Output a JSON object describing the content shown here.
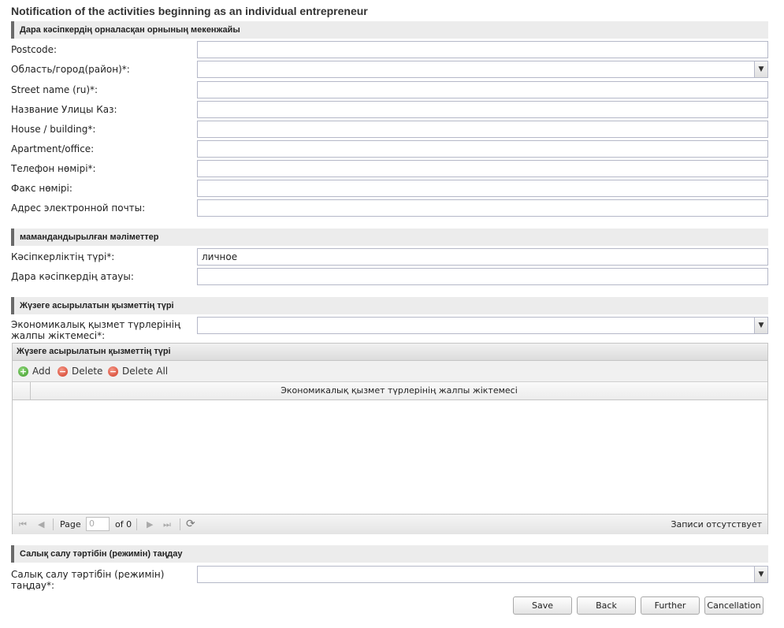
{
  "page": {
    "title": "Notification of the activities beginning as an individual entrepreneur"
  },
  "section_address": {
    "header": "Дара кәсіпкердің орналасқан орнының мекенжайы",
    "fields": [
      {
        "label": "Postcode:",
        "value": ""
      },
      {
        "label": "Область/город(район)*:",
        "value": ""
      },
      {
        "label": "Street name (ru)*:",
        "value": ""
      },
      {
        "label": "Название Улицы Каз:",
        "value": ""
      },
      {
        "label": "House / building*:",
        "value": ""
      },
      {
        "label": "Apartment/office:",
        "value": ""
      },
      {
        "label": "Телефон нөмірі*:",
        "value": ""
      },
      {
        "label": "Факс нөмірі:",
        "value": ""
      },
      {
        "label": "Адрес электронной почты:",
        "value": ""
      }
    ]
  },
  "section_specialized": {
    "header": "мамандандырылған мәліметтер",
    "fields": [
      {
        "label": "Кәсіпкерліктің түрі*:",
        "value": "личное"
      },
      {
        "label": "Дара кәсіпкердің атауы:",
        "value": ""
      }
    ]
  },
  "section_activity": {
    "header": "Жүзеге асырылатын қызметтің түрі",
    "classifier_label": "Экономикалық қызмет түрлерінің жалпы жіктемесі*:",
    "classifier_value": "",
    "grid": {
      "title": "Жүзеге асырылатын қызметтің түрі",
      "toolbar": {
        "add": "Add",
        "delete": "Delete",
        "delete_all": "Delete All"
      },
      "column": "Экономикалық қызмет түрлерінің жалпы жіктемесі",
      "pager": {
        "page_label": "Page",
        "page_value": "0",
        "of_label": "of 0",
        "empty_text": "Записи отсутствует"
      }
    }
  },
  "section_tax": {
    "header": "Салық салу тәртібін (режимін) таңдау",
    "field_label": "Салық салу тәртібін (режимін) таңдау*:",
    "field_value": ""
  },
  "buttons": {
    "save": "Save",
    "back": "Back",
    "further": "Further",
    "cancel": "Cancellation"
  }
}
